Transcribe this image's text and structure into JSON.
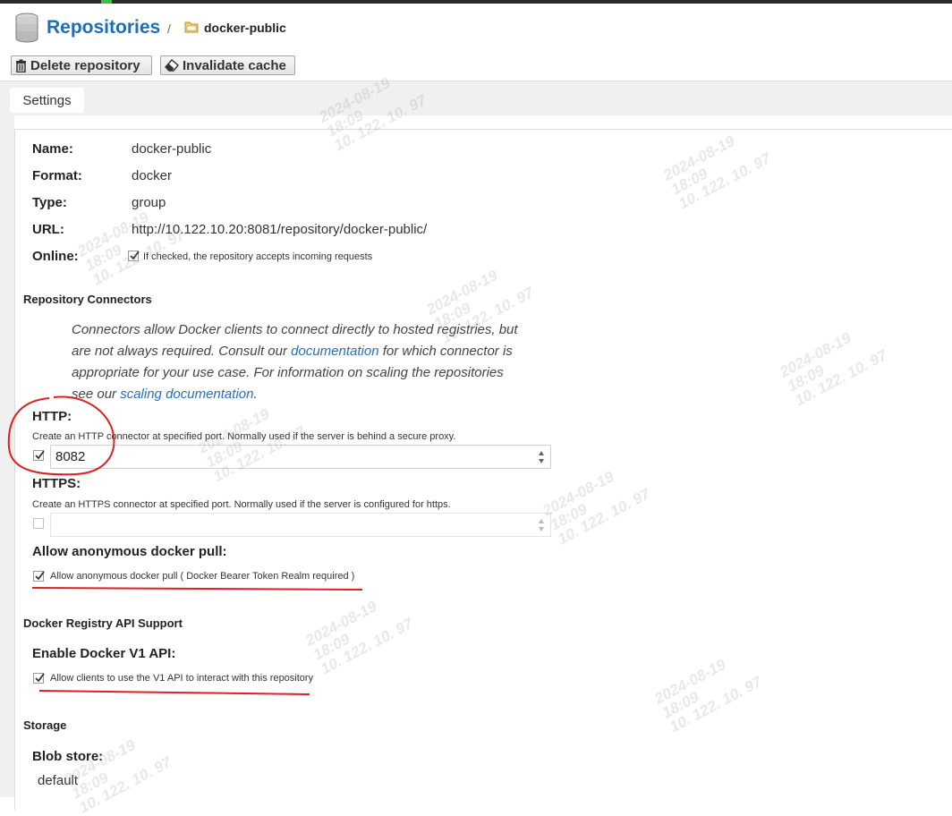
{
  "header": {
    "title": "Repositories",
    "separator": "/",
    "current": "docker-public"
  },
  "toolbar": {
    "delete_label": "Delete repository",
    "invalidate_label": "Invalidate cache"
  },
  "tabs": [
    {
      "label": "Settings"
    }
  ],
  "details": {
    "name_label": "Name:",
    "name_value": "docker-public",
    "format_label": "Format:",
    "format_value": "docker",
    "type_label": "Type:",
    "type_value": "group",
    "url_label": "URL:",
    "url_value": "http://10.122.10.20:8081/repository/docker-public/",
    "online_label": "Online:",
    "online_help": "If checked, the repository accepts incoming requests",
    "online_checked": true
  },
  "connectors": {
    "section_title": "Repository Connectors",
    "para_1": "Connectors allow Docker clients to connect directly to hosted registries, but are not always required. Consult our ",
    "link_1": "documentation",
    "para_2": " for which connector is appropriate for your use case. For information on scaling the repositories see our ",
    "link_2": "scaling documentation",
    "para_3": ".",
    "http_label": "HTTP:",
    "http_help": "Create an HTTP connector at specified port. Normally used if the server is behind a secure proxy.",
    "http_checked": true,
    "http_port": "8082",
    "https_label": "HTTPS:",
    "https_help": "Create an HTTPS connector at specified port. Normally used if the server is configured for https.",
    "https_checked": false,
    "https_port": "",
    "anon_label": "Allow anonymous docker pull:",
    "anon_help": "Allow anonymous docker pull ( Docker Bearer Token Realm required )",
    "anon_checked": true
  },
  "api": {
    "section_title": "Docker Registry API Support",
    "v1_label": "Enable Docker V1 API:",
    "v1_help": "Allow clients to use the V1 API to interact with this repository",
    "v1_checked": true
  },
  "storage": {
    "section_title": "Storage",
    "blob_label": "Blob store:",
    "blob_value": "default"
  },
  "watermark": {
    "date": "2024-08-19",
    "time": "18:09",
    "ip": "10. 122. 10. 97"
  },
  "colors": {
    "accent": "#1a6fb5",
    "link": "#2a6db8",
    "annotation": "#e02020"
  }
}
